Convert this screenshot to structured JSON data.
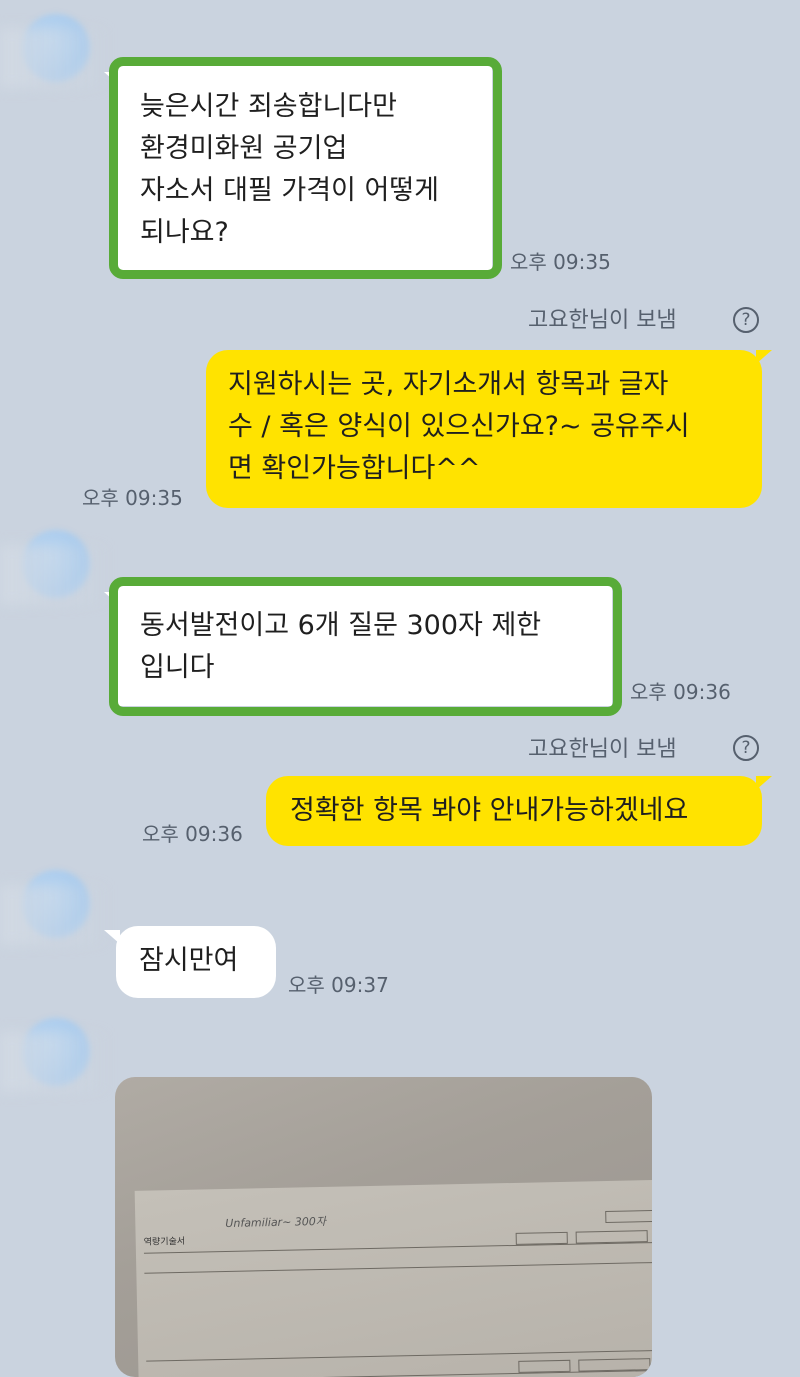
{
  "messages": {
    "m1": {
      "lines": [
        "늦은시간 죄송합니다만",
        "환경미화원 공기업",
        "자소서 대필 가격이 어떻게",
        "되나요?"
      ],
      "time": "오후 09:35"
    },
    "m2": {
      "sender": "고요한님이 보냄",
      "lines": [
        "지원하시는 곳, 자기소개서 항목과 글자",
        "수 / 혹은 양식이 있으신가요?~ 공유주시",
        "면 확인가능합니다^^"
      ],
      "time": "오후 09:35"
    },
    "m3": {
      "lines": [
        "동서발전이고 6개 질문 300자 제한",
        "입니다"
      ],
      "time": "오후 09:36"
    },
    "m4": {
      "sender": "고요한님이 보냄",
      "text": "정확한 항목 봐야 안내가능하겠네요",
      "time": "오후 09:36"
    },
    "m5": {
      "text": "잠시만여",
      "time": "오후 09:37"
    }
  },
  "photo": {
    "doc_title": "역량기술서",
    "doc_handwriting": "Unfamiliar~ 300자"
  },
  "help_icon_glyph": "?",
  "colors": {
    "background": "#cad3df",
    "my_bubble": "#ffe300",
    "their_bubble": "#ffffff",
    "highlight": "#58ab38"
  }
}
